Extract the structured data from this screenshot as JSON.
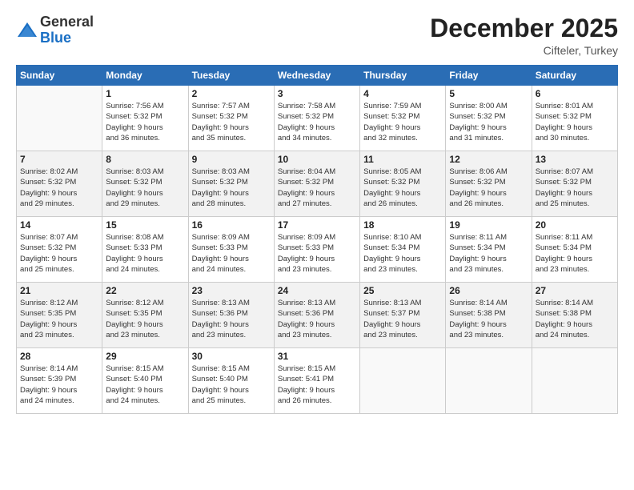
{
  "logo": {
    "general": "General",
    "blue": "Blue"
  },
  "title": "December 2025",
  "location": "Cifteler, Turkey",
  "weekdays": [
    "Sunday",
    "Monday",
    "Tuesday",
    "Wednesday",
    "Thursday",
    "Friday",
    "Saturday"
  ],
  "weeks": [
    [
      {
        "day": "",
        "info": ""
      },
      {
        "day": "1",
        "info": "Sunrise: 7:56 AM\nSunset: 5:32 PM\nDaylight: 9 hours\nand 36 minutes."
      },
      {
        "day": "2",
        "info": "Sunrise: 7:57 AM\nSunset: 5:32 PM\nDaylight: 9 hours\nand 35 minutes."
      },
      {
        "day": "3",
        "info": "Sunrise: 7:58 AM\nSunset: 5:32 PM\nDaylight: 9 hours\nand 34 minutes."
      },
      {
        "day": "4",
        "info": "Sunrise: 7:59 AM\nSunset: 5:32 PM\nDaylight: 9 hours\nand 32 minutes."
      },
      {
        "day": "5",
        "info": "Sunrise: 8:00 AM\nSunset: 5:32 PM\nDaylight: 9 hours\nand 31 minutes."
      },
      {
        "day": "6",
        "info": "Sunrise: 8:01 AM\nSunset: 5:32 PM\nDaylight: 9 hours\nand 30 minutes."
      }
    ],
    [
      {
        "day": "7",
        "info": "Sunrise: 8:02 AM\nSunset: 5:32 PM\nDaylight: 9 hours\nand 29 minutes."
      },
      {
        "day": "8",
        "info": "Sunrise: 8:03 AM\nSunset: 5:32 PM\nDaylight: 9 hours\nand 29 minutes."
      },
      {
        "day": "9",
        "info": "Sunrise: 8:03 AM\nSunset: 5:32 PM\nDaylight: 9 hours\nand 28 minutes."
      },
      {
        "day": "10",
        "info": "Sunrise: 8:04 AM\nSunset: 5:32 PM\nDaylight: 9 hours\nand 27 minutes."
      },
      {
        "day": "11",
        "info": "Sunrise: 8:05 AM\nSunset: 5:32 PM\nDaylight: 9 hours\nand 26 minutes."
      },
      {
        "day": "12",
        "info": "Sunrise: 8:06 AM\nSunset: 5:32 PM\nDaylight: 9 hours\nand 26 minutes."
      },
      {
        "day": "13",
        "info": "Sunrise: 8:07 AM\nSunset: 5:32 PM\nDaylight: 9 hours\nand 25 minutes."
      }
    ],
    [
      {
        "day": "14",
        "info": "Sunrise: 8:07 AM\nSunset: 5:32 PM\nDaylight: 9 hours\nand 25 minutes."
      },
      {
        "day": "15",
        "info": "Sunrise: 8:08 AM\nSunset: 5:33 PM\nDaylight: 9 hours\nand 24 minutes."
      },
      {
        "day": "16",
        "info": "Sunrise: 8:09 AM\nSunset: 5:33 PM\nDaylight: 9 hours\nand 24 minutes."
      },
      {
        "day": "17",
        "info": "Sunrise: 8:09 AM\nSunset: 5:33 PM\nDaylight: 9 hours\nand 23 minutes."
      },
      {
        "day": "18",
        "info": "Sunrise: 8:10 AM\nSunset: 5:34 PM\nDaylight: 9 hours\nand 23 minutes."
      },
      {
        "day": "19",
        "info": "Sunrise: 8:11 AM\nSunset: 5:34 PM\nDaylight: 9 hours\nand 23 minutes."
      },
      {
        "day": "20",
        "info": "Sunrise: 8:11 AM\nSunset: 5:34 PM\nDaylight: 9 hours\nand 23 minutes."
      }
    ],
    [
      {
        "day": "21",
        "info": "Sunrise: 8:12 AM\nSunset: 5:35 PM\nDaylight: 9 hours\nand 23 minutes."
      },
      {
        "day": "22",
        "info": "Sunrise: 8:12 AM\nSunset: 5:35 PM\nDaylight: 9 hours\nand 23 minutes."
      },
      {
        "day": "23",
        "info": "Sunrise: 8:13 AM\nSunset: 5:36 PM\nDaylight: 9 hours\nand 23 minutes."
      },
      {
        "day": "24",
        "info": "Sunrise: 8:13 AM\nSunset: 5:36 PM\nDaylight: 9 hours\nand 23 minutes."
      },
      {
        "day": "25",
        "info": "Sunrise: 8:13 AM\nSunset: 5:37 PM\nDaylight: 9 hours\nand 23 minutes."
      },
      {
        "day": "26",
        "info": "Sunrise: 8:14 AM\nSunset: 5:38 PM\nDaylight: 9 hours\nand 23 minutes."
      },
      {
        "day": "27",
        "info": "Sunrise: 8:14 AM\nSunset: 5:38 PM\nDaylight: 9 hours\nand 24 minutes."
      }
    ],
    [
      {
        "day": "28",
        "info": "Sunrise: 8:14 AM\nSunset: 5:39 PM\nDaylight: 9 hours\nand 24 minutes."
      },
      {
        "day": "29",
        "info": "Sunrise: 8:15 AM\nSunset: 5:40 PM\nDaylight: 9 hours\nand 24 minutes."
      },
      {
        "day": "30",
        "info": "Sunrise: 8:15 AM\nSunset: 5:40 PM\nDaylight: 9 hours\nand 25 minutes."
      },
      {
        "day": "31",
        "info": "Sunrise: 8:15 AM\nSunset: 5:41 PM\nDaylight: 9 hours\nand 26 minutes."
      },
      {
        "day": "",
        "info": ""
      },
      {
        "day": "",
        "info": ""
      },
      {
        "day": "",
        "info": ""
      }
    ]
  ]
}
